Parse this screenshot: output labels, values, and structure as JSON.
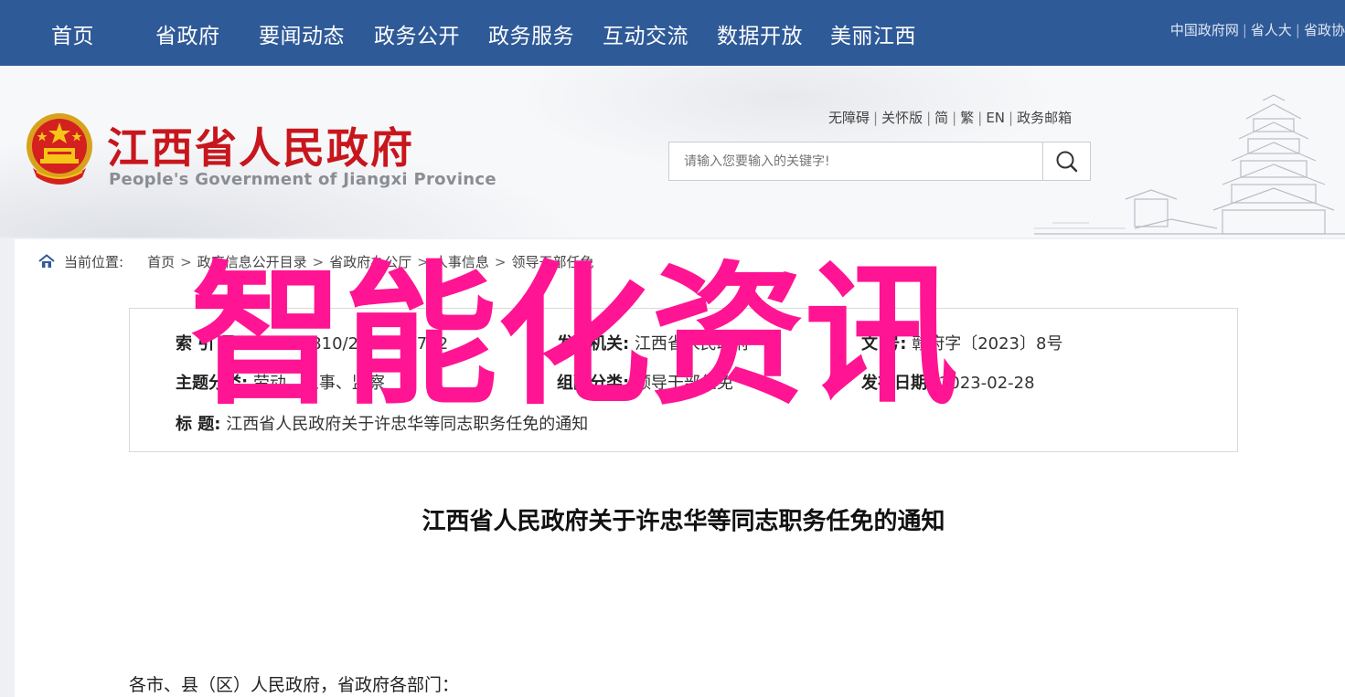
{
  "topnav": {
    "items": [
      "首页",
      "省政府",
      "要闻动态",
      "政务公开",
      "政务服务",
      "互动交流",
      "数据开放",
      "美丽江西"
    ],
    "links": [
      "中国政府网",
      "省人大",
      "省政协"
    ]
  },
  "header": {
    "title": "江西省人民政府",
    "subtitle": "People's Government of Jiangxi Province",
    "util_links": [
      "无障碍",
      "关怀版",
      "简",
      "繁",
      "EN",
      "政务邮箱"
    ],
    "search_placeholder": "请输入您要输入的关键字!"
  },
  "breadcrumb": {
    "label": "当前位置:",
    "items": [
      "首页",
      "政府信息公开目录",
      "省政府办公厅",
      "人事信息",
      "领导干部任免"
    ]
  },
  "meta": {
    "index_key": "索 引 号:",
    "index_val": "014500810/2023-75732",
    "issuer_key": "发文机关:",
    "issuer_val": "江西省人民政府",
    "docno_key": "文 号:",
    "docno_val": "赣府字〔2023〕8号",
    "topic_key": "主题分类:",
    "topic_val": "劳动、人事、监察",
    "group_key": "组配分类:",
    "group_val": "领导干部任免",
    "date_key": "发布日期:",
    "date_val": "2023-02-28",
    "title_key": "标 题:",
    "title_val": "江西省人民政府关于许忠华等同志职务任免的通知"
  },
  "document": {
    "title": "江西省人民政府关于许忠华等同志职务任免的通知",
    "salutation": "各市、县（区）人民政府，省政府各部门："
  },
  "watermark": "智能化资讯",
  "colors": {
    "nav_bg": "#2f5a98",
    "title_red": "#c8161d",
    "watermark_pink": "#ff1493"
  }
}
